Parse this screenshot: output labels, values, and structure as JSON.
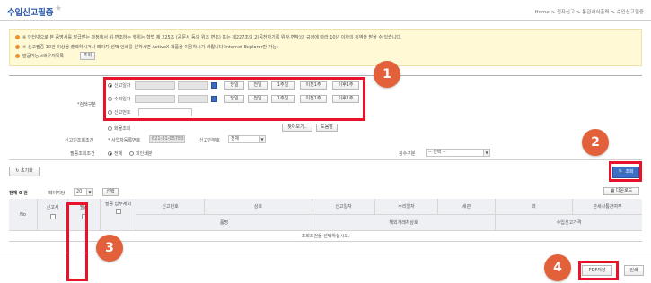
{
  "page": {
    "title": "수입신고필증",
    "breadcrumb": "Home > 전자신고 > 통관서식출력 > 수입신고필증"
  },
  "notice": {
    "line1": "※ 인터넷으로 본 증명서를 발급받는 과정에서 위·변조하는 행위는 형법 제 225조 (공문서 등의 위조 변조) 또는 제227조의 2(공전자기록 위작·변작)의 규정에 따라 10년 이하의 징역을 받을 수 있습니다.",
    "line2": "※ 신고필증 10건 이상을 출력하시거나 페이지 선택 인쇄를 원하시면 ActiveX 제품을 이용하시기 바랍니다(Internet Explorer만 가능)",
    "line3": "발급가능브라우저목록",
    "line3_button": "조회"
  },
  "search": {
    "period_label": "*검색구분",
    "options": [
      {
        "label": "신고일자",
        "selected": true
      },
      {
        "label": "수리일자",
        "selected": false
      },
      {
        "label": "신고번호",
        "selected": false
      }
    ],
    "quick_buttons": [
      "당일",
      "전일",
      "1주일",
      "이전1주",
      "이후1주"
    ],
    "extra_option": "화물조회",
    "lookup_button": "찾아보기..",
    "clear_button": "도움말",
    "condition_label": "신고인조회조건",
    "condition_text": "* 사업자등록번호",
    "condition_value": "621-81-05780",
    "division_label": "신고인부호",
    "division_value": "전체",
    "target_label": "필증조회조건",
    "target_all": "전체",
    "target_unissued": "미인쇄분",
    "receipt_label": "징수구분",
    "receipt_value": "-- 선택 --",
    "reset_button": "초기화",
    "search_button": "조회"
  },
  "results": {
    "total_label": "전체 0 건",
    "page_size_label": "페이지당",
    "page_size_value": "20",
    "select_button": "선택",
    "download_button": "다운로드",
    "headers_row1": [
      "No",
      "신고서",
      "필증",
      "필증 납부제외",
      "신고번호",
      "상호",
      "신고일자",
      "수리일자",
      "세관",
      "과",
      "관세사통관여부"
    ],
    "headers_row2": [
      "품명",
      "해외거래처상호",
      "수입신고가격"
    ],
    "empty_message": "조회조건을 선택하십시오.",
    "pdf_button": "PDF저장",
    "print_button": "인쇄"
  },
  "markers": [
    "1",
    "2",
    "3",
    "4"
  ],
  "colors": {
    "accent": "#2a58a8",
    "annotation": "#e8132a",
    "marker": "#e2613a",
    "notice_bg": "#fff9d6"
  }
}
